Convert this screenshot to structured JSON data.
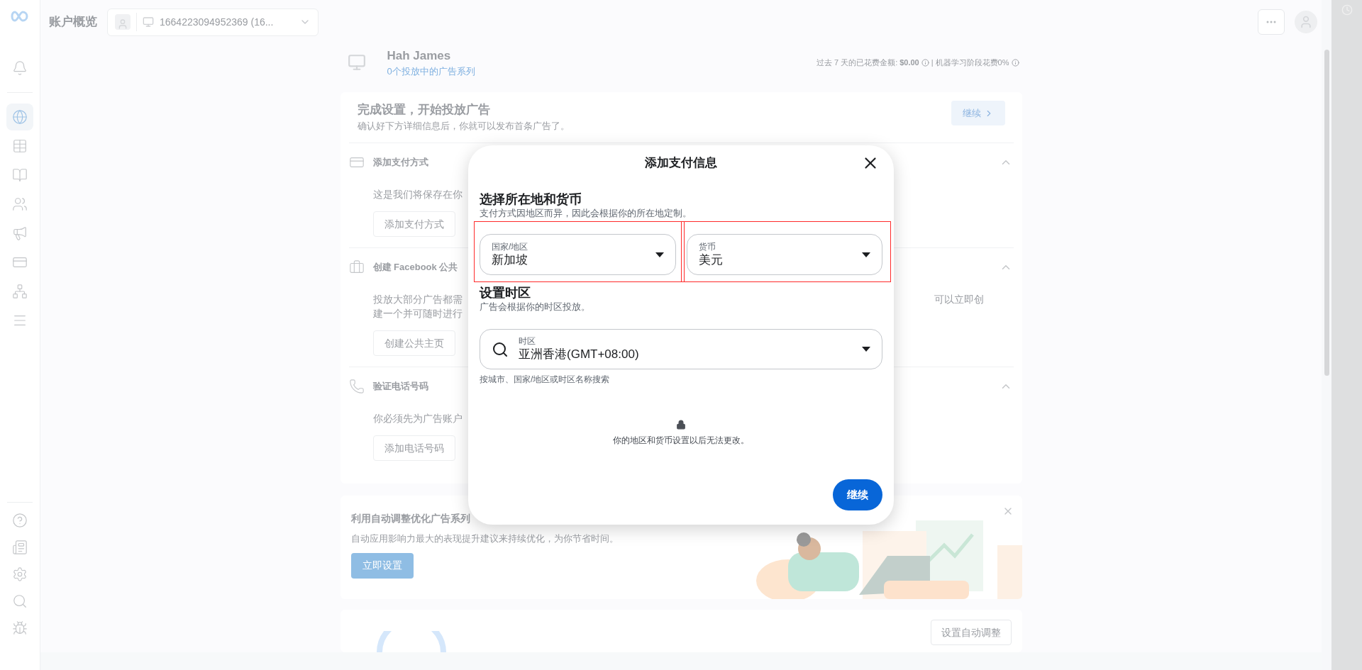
{
  "sidebar": {
    "top_items": [
      {
        "selected": false
      }
    ],
    "nav_items": [
      {
        "selected": true
      },
      {
        "selected": false
      },
      {
        "selected": false
      },
      {
        "selected": false
      },
      {
        "selected": false
      },
      {
        "selected": false
      },
      {
        "selected": false
      },
      {
        "selected": false
      }
    ],
    "bottom_items": [
      {
        "selected": false
      },
      {
        "selected": false
      },
      {
        "selected": false
      },
      {
        "selected": false
      },
      {
        "selected": false
      }
    ]
  },
  "header": {
    "title": "账户概览",
    "account": "1664223094952369 (16..."
  },
  "campaign_header": {
    "name": "Hah James",
    "subtitle": "0个投放中的广告系列",
    "spend_label": "过去 7 天的已花费金额:",
    "spend_value": "$0.00",
    "separator": "|",
    "ml_label": "机器学习阶段花费0%"
  },
  "setup_card": {
    "title": "完成设置，开始投放广告",
    "subtitle": "确认好下方详细信息后，你就可以发布首条广告了。",
    "continue_button": "继续",
    "sections": [
      {
        "kind": "card",
        "title": "添加支付方式",
        "description_lines": [
          "这是我们将保存在你"
        ],
        "button": "添加支付方式",
        "expanded": true
      },
      {
        "kind": "page",
        "title": "创建 Facebook 公共",
        "description_lines": [
          "投放大部分广告都需",
          "建一个并可随时进行"
        ],
        "description_tail": "可以立即创",
        "button": "创建公共主页",
        "expanded": true
      },
      {
        "kind": "phone",
        "title": "验证电话号码",
        "description_lines": [
          "你必须先为广告账户"
        ],
        "button": "添加电话号码",
        "expanded": true
      }
    ]
  },
  "auto_card": {
    "title": "利用自动调整优化广告系列",
    "subtitle": "自动应用影响力最大的表现提升建议来持续优化，为你节省时间。",
    "button": "立即设置"
  },
  "auto_setup_card": {
    "button": "设置自动调整"
  },
  "modal": {
    "title": "添加支付信息",
    "location_heading": "选择所在地和货币",
    "location_subtitle": "支付方式因地区而异，因此会根据你的所在地定制。",
    "fields": [
      {
        "kind": "select",
        "label": "国家/地区",
        "value": "新加坡",
        "highlighted": true
      },
      {
        "kind": "select",
        "label": "货币",
        "value": "美元",
        "highlighted": true
      }
    ],
    "timezone_heading": "设置时区",
    "timezone_subtitle": "广告会根据你的时区投放。",
    "timezone_field": {
      "kind": "search",
      "label": "时区",
      "value": "亚洲香港(GMT+08:00)"
    },
    "timezone_helper": "按城市、国家/地区或时区名称搜索",
    "lock_note": "你的地区和货币设置以后无法更改。",
    "continue_button": "继续"
  }
}
